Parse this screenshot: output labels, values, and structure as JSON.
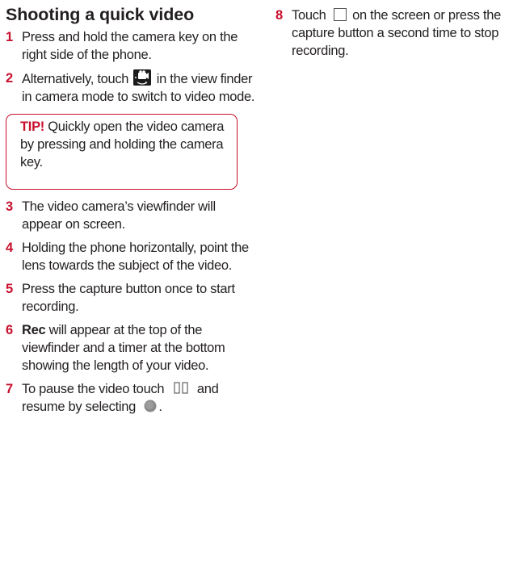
{
  "section": {
    "title": "Shooting a quick video"
  },
  "steps": [
    {
      "num": "1",
      "text": "Press and hold the camera key on the right side of the phone."
    },
    {
      "num": "2",
      "text_before": "Alternatively, touch",
      "text_after": "in the view finder in camera mode to switch to video mode.",
      "icon": "video-mode-icon"
    },
    {
      "num": "3",
      "text": "The video camera’s viewfinder will appear on screen."
    },
    {
      "num": "4",
      "text": "Holding the phone horizontally, point the lens towards the subject of the video."
    },
    {
      "num": "5",
      "text": "Press the capture button once to start recording."
    },
    {
      "num": "6",
      "bold": "Rec",
      "text": "will appear at the top of the viewfinder and a timer at the bottom showing the length of your video."
    },
    {
      "num": "7",
      "text_before": "To pause the video touch",
      "text_middle": "and resume by selecting",
      "text_end": ".",
      "icon_pause": "pause-icon",
      "icon_resume": "record-circle-icon"
    },
    {
      "num": "8",
      "text_before": "Touch",
      "text_after": "on the screen or press the capture button a second time to stop recording.",
      "icon": "stop-square-icon"
    }
  ],
  "tip": {
    "label": "TIP!",
    "text": "Quickly open the video camera by pressing and holding the camera key."
  },
  "colors": {
    "accent": "#c8102e",
    "text": "#231f20"
  }
}
